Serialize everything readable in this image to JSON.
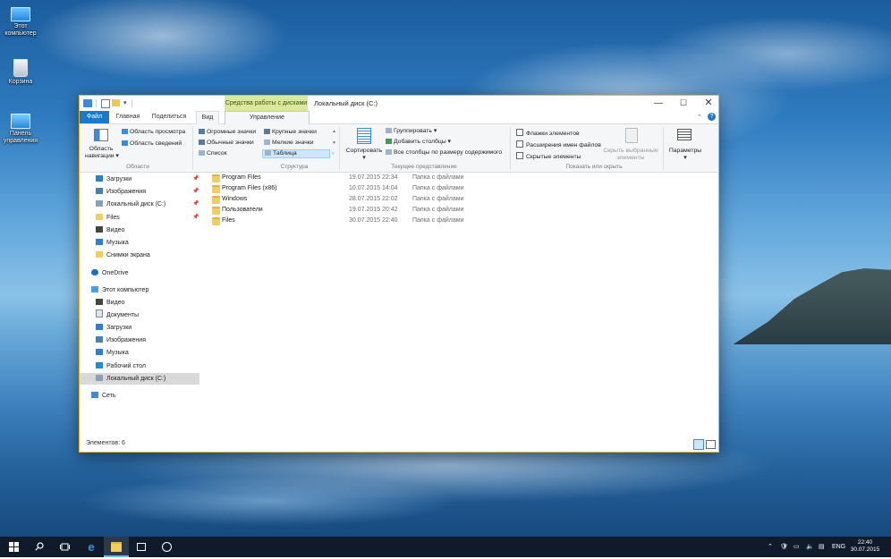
{
  "desktop": {
    "icons": [
      {
        "label": "Этот компьютер"
      },
      {
        "label": "Корзина"
      },
      {
        "label": "Панель управления"
      }
    ]
  },
  "window": {
    "title": "Локальный диск (C:)",
    "context_tab_header": "Средства работы с дисками",
    "min_glyph": "—",
    "max_glyph": "☐",
    "close_glyph": "✕",
    "qat_dropdown": "▾",
    "tabs": {
      "file": "Файл",
      "home": "Главная",
      "share": "Поделиться",
      "view": "Вид",
      "manage": "Управление"
    },
    "help_glyph": "?",
    "help_chevron": "⌃"
  },
  "ribbon": {
    "panes": {
      "nav_pane_line1": "Область",
      "nav_pane_line2": "навигации ▾",
      "preview_pane": "Область просмотра",
      "details_pane": "Область сведений",
      "label": "Области"
    },
    "layout": {
      "extra_large": "Огромные значки",
      "large": "Крупные значки",
      "medium": "Обычные значки",
      "small": "Мелкие значки",
      "list": "Список",
      "details": "Таблица",
      "label": "Структура"
    },
    "current_view": {
      "sort_by": "Сортировать",
      "sort_arrow": "▾",
      "group_by": "Группировать ▾",
      "add_columns": "Добавить столбцы ▾",
      "size_columns": "Все столбцы по размеру содержимого",
      "label": "Текущее представление"
    },
    "show_hide": {
      "item_checkboxes": "Флажки элементов",
      "file_extensions": "Расширения имен файлов",
      "hidden_items": "Скрытые элементы",
      "hide_selected_line1": "Скрыть выбранные",
      "hide_selected_line2": "элементы",
      "label": "Показать или скрыть"
    },
    "options": {
      "label": "Параметры",
      "arrow": "▾"
    }
  },
  "navpane": {
    "quick_access": [
      {
        "label": "Загрузки",
        "pinned": true
      },
      {
        "label": "Изображения",
        "pinned": true
      },
      {
        "label": "Локальный диск (C:)",
        "pinned": true
      },
      {
        "label": "Files",
        "pinned": true
      },
      {
        "label": "Видео",
        "pinned": false
      },
      {
        "label": "Музыка",
        "pinned": false
      },
      {
        "label": "Снимки экрана",
        "pinned": false
      }
    ],
    "onedrive": "OneDrive",
    "this_pc": "Этот компьютер",
    "this_pc_items": [
      {
        "label": "Видео"
      },
      {
        "label": "Документы"
      },
      {
        "label": "Загрузки"
      },
      {
        "label": "Изображения"
      },
      {
        "label": "Музыка"
      },
      {
        "label": "Рабочий стол"
      },
      {
        "label": "Локальный диск (C:)",
        "selected": true
      }
    ],
    "network": "Сеть",
    "pin_glyph": "📌"
  },
  "files": [
    {
      "name": "Program Files",
      "date": "19.07.2015 22:34",
      "type": "Папка с файлами"
    },
    {
      "name": "Program Files (x86)",
      "date": "10.07.2015 14:04",
      "type": "Папка с файлами"
    },
    {
      "name": "Windows",
      "date": "28.07.2015 22:02",
      "type": "Папка с файлами"
    },
    {
      "name": "Пользователи",
      "date": "19.07.2015 20:42",
      "type": "Папка с файлами"
    },
    {
      "name": "Files",
      "date": "30.07.2015 22:40",
      "type": "Папка с файлами"
    }
  ],
  "status": {
    "item_count": "Элементов: 6"
  },
  "taskbar": {
    "tray_lang": "ENG",
    "time": "22:40",
    "date": "30.07.2015"
  },
  "colors": {
    "accent": "#1979ca",
    "context_tab": "#dbe89b",
    "selected_nav": "#d9d9d9",
    "window_border": "#e6b830",
    "taskbar": "#0f1b2a"
  }
}
